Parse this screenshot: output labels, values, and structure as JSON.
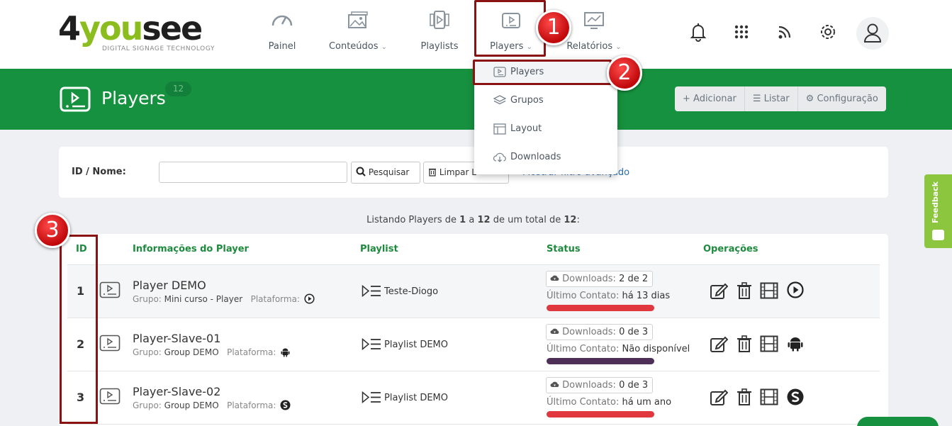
{
  "logo": {
    "part1": "4",
    "part2": "you",
    "part3": "see",
    "tagline": "DIGITAL SIGNAGE TECHNOLOGY"
  },
  "nav": {
    "items": [
      {
        "label": "Painel",
        "icon": "gauge-icon"
      },
      {
        "label": "Conteúdos",
        "icon": "images-icon",
        "caret": "⌄"
      },
      {
        "label": "Playlists",
        "icon": "playlist-icon"
      },
      {
        "label": "Players",
        "icon": "player-icon",
        "caret": "⌄"
      },
      {
        "label": "Relatórios",
        "icon": "chart-icon",
        "caret": "⌄"
      }
    ],
    "right_icons": [
      "bell-icon",
      "apps-grid-icon",
      "rss-icon",
      "gear-icon",
      "user-icon"
    ]
  },
  "dropdown": {
    "items": [
      {
        "label": "Players",
        "icon": "player-icon"
      },
      {
        "label": "Grupos",
        "icon": "layers-icon"
      },
      {
        "label": "Layout",
        "icon": "layout-icon"
      },
      {
        "label": "Downloads",
        "icon": "cloud-download-icon"
      }
    ]
  },
  "annotations": {
    "one": "1",
    "two": "2",
    "three": "3",
    "color": "#c0080a"
  },
  "header": {
    "title": "Players",
    "count": "12",
    "actions": [
      {
        "label": "+ Adicionar",
        "icon": "plus-icon"
      },
      {
        "label": "☰ Listar",
        "icon": "list-icon"
      },
      {
        "label": "⚙ Configuração",
        "icon": "gear-icon"
      }
    ]
  },
  "search": {
    "label": "ID / Nome:",
    "value": "",
    "search_button": "Pesquisar",
    "clear_button": "Limpar L",
    "advanced_link": "Mostrar filtro avançado"
  },
  "listing": {
    "prefix": "Listando Players de",
    "from": "1",
    "sep1": "a",
    "to": "12",
    "sep2": "de um total de",
    "total": "12",
    "suffix": ":"
  },
  "table": {
    "headers": {
      "id": "ID",
      "info": "Informações do Player",
      "playlist": "Playlist",
      "status": "Status",
      "ops": "Operações"
    },
    "rows": [
      {
        "id": "1",
        "name": "Player DEMO",
        "group_label": "Grupo:",
        "group": "Mini curso - Player",
        "platform_label": "Plataforma:",
        "platform_icon": "play-circle-icon",
        "playlist": "Teste-Diogo",
        "downloads_label": "Downloads:",
        "downloads": "2 de 2",
        "contact_label": "Último Contato:",
        "contact": "há 13 dias",
        "status_color": "#e0383e",
        "ops": [
          "edit-icon",
          "trash-icon",
          "film-icon",
          "play-circle-icon"
        ]
      },
      {
        "id": "2",
        "name": "Player-Slave-01",
        "group_label": "Grupo:",
        "group": "Group DEMO",
        "platform_label": "Plataforma:",
        "platform_icon": "android-icon",
        "playlist": "Playlist DEMO",
        "downloads_label": "Downloads:",
        "downloads": "0 de 3",
        "contact_label": "Último Contato:",
        "contact": "Não disponível",
        "status_color": "#4d2f58",
        "ops": [
          "edit-icon",
          "trash-icon",
          "film-icon",
          "android-icon"
        ]
      },
      {
        "id": "3",
        "name": "Player-Slave-02",
        "group_label": "Grupo:",
        "group": "Group DEMO",
        "platform_label": "Plataforma:",
        "platform_icon": "s-logo-icon",
        "playlist": "Playlist DEMO",
        "downloads_label": "Downloads:",
        "downloads": "0 de 3",
        "contact_label": "Último Contato:",
        "contact": "há um ano",
        "status_color": "#e0383e",
        "ops": [
          "edit-icon",
          "trash-icon",
          "film-icon",
          "s-logo-icon"
        ]
      }
    ]
  },
  "feedback": {
    "label": "Feedback"
  },
  "colors": {
    "brand_green": "#16913f",
    "accent_green": "#1e8a3e",
    "annotation_red": "#8a1212"
  }
}
